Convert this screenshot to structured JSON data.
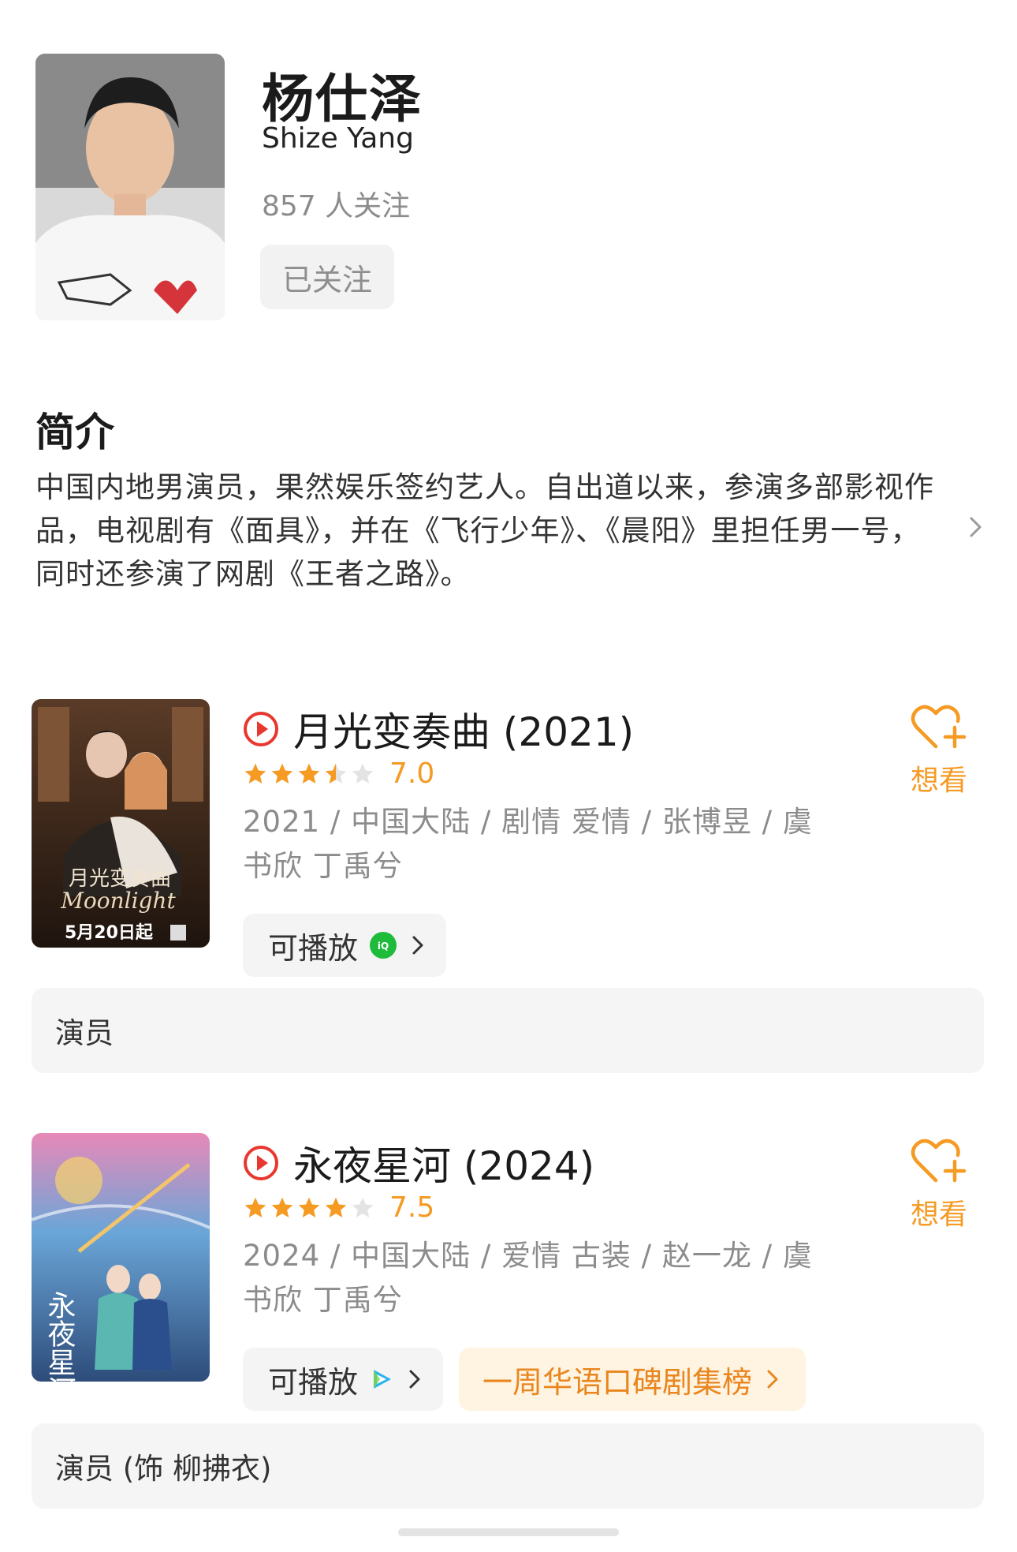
{
  "profile": {
    "name": "杨仕泽",
    "english_name": "Shize Yang",
    "followers": "857 人关注",
    "follow_button": "已关注"
  },
  "intro": {
    "title": "简介",
    "text": "中国内地男演员，果然娱乐签约艺人。自出道以来，参演多部影视作品，电视剧有《面具》，并在《飞行少年》、《晨阳》里担任男一号，同时还参演了网剧《王者之路》。"
  },
  "works": [
    {
      "title": "月光变奏曲 (2021)",
      "rating_stars": 3.5,
      "score": "7.0",
      "meta": "2021 / 中国大陆 / 剧情 爱情 / 张博昱 / 虞书欣 丁禹兮",
      "play_label": "可播放",
      "platform_icon": "iqiyi-icon",
      "want_label": "想看",
      "role": "演员",
      "poster_text": "月光变奏曲",
      "poster_script": "Moonlight",
      "poster_date": "5月20日起"
    },
    {
      "title": "永夜星河 (2024)",
      "rating_stars": 4,
      "score": "7.5",
      "meta": "2024 / 中国大陆 / 爱情 古装 / 赵一龙 / 虞书欣 丁禹兮",
      "play_label": "可播放",
      "platform_icon": "tencent-video-icon",
      "rank_label": "一周华语口碑剧集榜",
      "want_label": "想看",
      "role": "演员 (饰 柳拂衣)",
      "poster_text": "永夜星河"
    }
  ],
  "colors": {
    "accent": "#f59a23",
    "play_red": "#e8372f",
    "iqiyi_green": "#1fbb3a"
  }
}
